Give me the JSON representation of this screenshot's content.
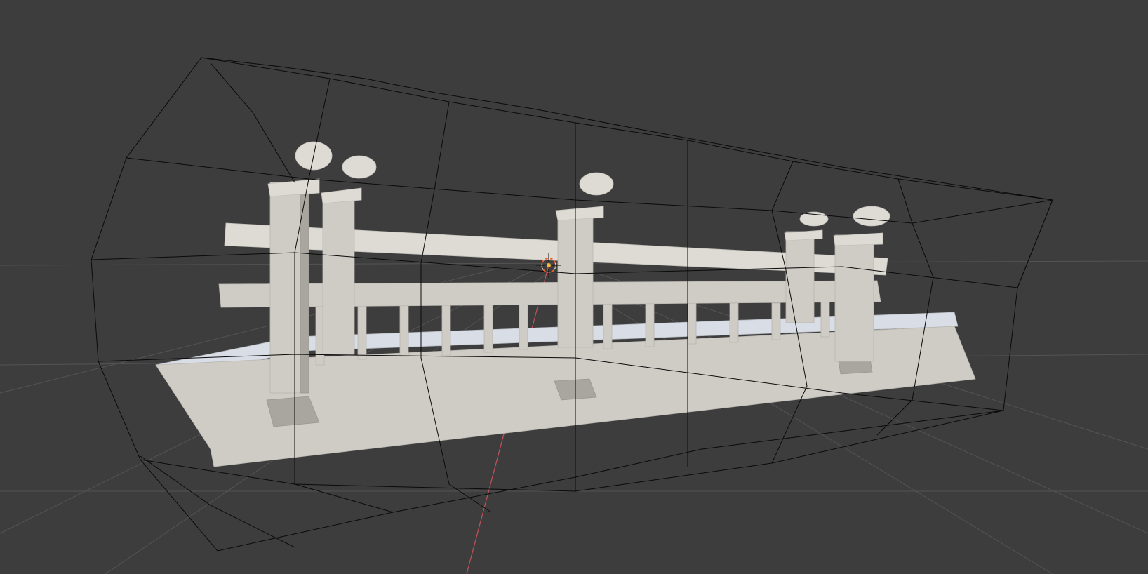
{
  "viewport": {
    "background": "#3d3d3d",
    "grid_color": "#545454",
    "x_axis_color": "#c0535a",
    "cage_color": "#0a0a0a",
    "model_color": "#cfccc6",
    "cursor_icon": "3d-cursor-icon"
  }
}
